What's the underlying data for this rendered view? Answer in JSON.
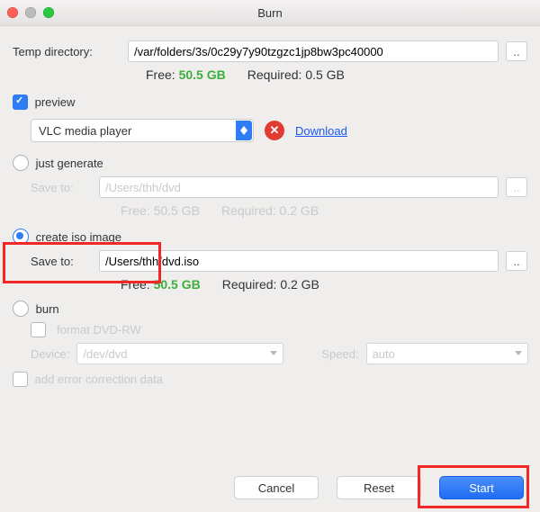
{
  "title": "Burn",
  "temp": {
    "label": "Temp directory:",
    "path": "/var/folders/3s/0c29y7y90tzgzc1jp8bw3pc40000",
    "browse": "..",
    "free_label": "Free:",
    "free_value": "50.5 GB",
    "req_label": "Required:",
    "req_value": "0.5 GB"
  },
  "preview": {
    "checked": true,
    "label": "preview",
    "player": "VLC media player",
    "download_link": "Download"
  },
  "just_generate": {
    "label": "just generate",
    "save_label": "Save to:",
    "save_path": "/Users/thh/dvd",
    "browse": "..",
    "free_label": "Free:",
    "free_value": "50.5 GB",
    "req_label": "Required:",
    "req_value": "0.2 GB"
  },
  "create_iso": {
    "label": "create iso image",
    "save_label": "Save to:",
    "save_path": "/Users/thh/dvd.iso",
    "browse": "..",
    "free_label": "Free:",
    "free_value": "50.5 GB",
    "req_label": "Required:",
    "req_value": "0.2 GB"
  },
  "burn": {
    "label": "burn",
    "format_label": "format DVD-RW",
    "device_label": "Device:",
    "device_value": "/dev/dvd",
    "speed_label": "Speed:",
    "speed_value": "auto"
  },
  "ecc": {
    "label": "add error correction data"
  },
  "buttons": {
    "cancel": "Cancel",
    "reset": "Reset",
    "start": "Start"
  }
}
